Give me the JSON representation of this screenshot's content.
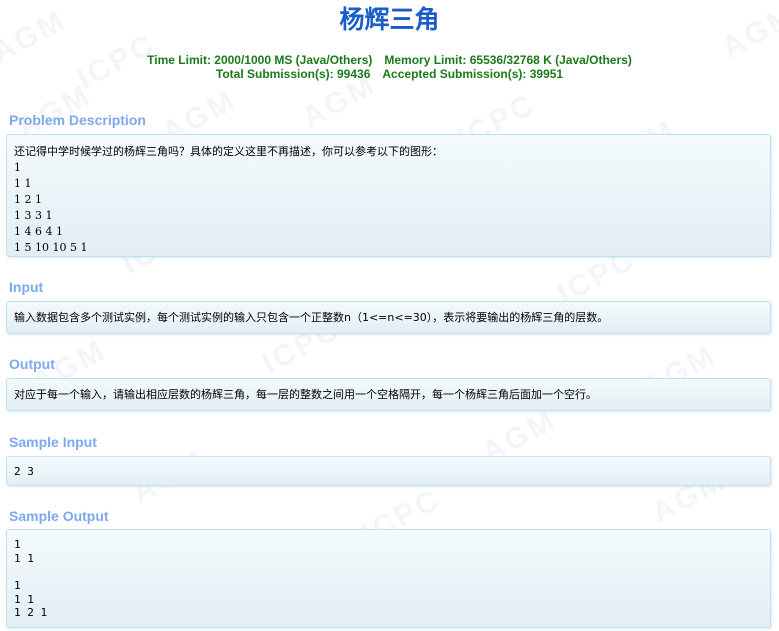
{
  "problem": {
    "title": "杨辉三角",
    "limits": {
      "time": "Time Limit: 2000/1000 MS (Java/Others)",
      "memory": "Memory Limit: 65536/32768 K (Java/Others)",
      "submissions": "Total Submission(s): 99436",
      "accepted": "Accepted Submission(s): 39951"
    },
    "sections": {
      "description_title": "Problem Description",
      "description_intro": "还记得中学时候学过的杨辉三角吗？具体的定义这里不再描述，你可以参考以下的图形：",
      "description_rows": [
        "1",
        "1 1",
        "1 2 1",
        "1 3 3 1",
        "1 4 6 4 1",
        "1 5 10 10 5 1"
      ],
      "input_title": "Input",
      "input_text": "输入数据包含多个测试实例，每个测试实例的输入只包含一个正整数n（1<=n<=30），表示将要输出的杨辉三角的层数。",
      "output_title": "Output",
      "output_text": "对应于每一个输入，请输出相应层数的杨辉三角，每一层的整数之间用一个空格隔开，每一个杨辉三角后面加一个空行。",
      "sample_input_title": "Sample Input",
      "sample_input": [
        "2 3"
      ],
      "sample_output_title": "Sample Output",
      "sample_output": [
        "1",
        "1 1",
        "",
        "1",
        "1 1",
        "1 2 1"
      ]
    },
    "watermark_text": [
      "AGM",
      "ICPC"
    ]
  }
}
